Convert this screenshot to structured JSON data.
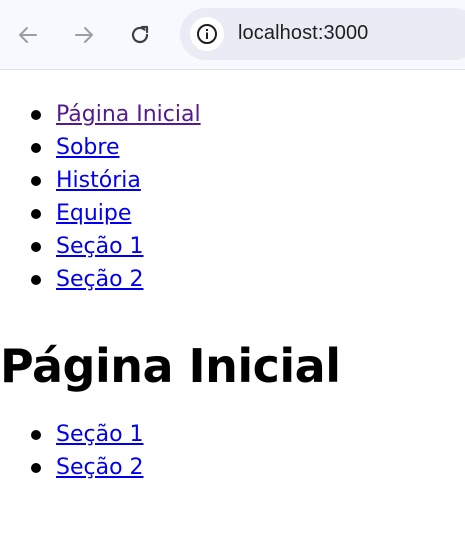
{
  "browser": {
    "address": "localhost:3000",
    "icons": {
      "back": "arrow-left-icon",
      "forward": "arrow-right-icon",
      "reload": "reload-icon",
      "site_info": "info-icon"
    }
  },
  "nav": {
    "items": [
      {
        "label": "Página Inicial",
        "visited": true
      },
      {
        "label": "Sobre"
      },
      {
        "label": "História"
      },
      {
        "label": "Equipe"
      },
      {
        "label": "Seção 1"
      },
      {
        "label": "Seção 2"
      }
    ]
  },
  "main": {
    "heading": "Página Inicial",
    "sections": [
      {
        "label": "Seção 1"
      },
      {
        "label": "Seção 2"
      }
    ]
  },
  "colors": {
    "link": "#0000ee",
    "visited_link": "#551a8b",
    "toolbar_bg": "#f8f9fe",
    "omnibox_bg": "#e9ecf5"
  }
}
